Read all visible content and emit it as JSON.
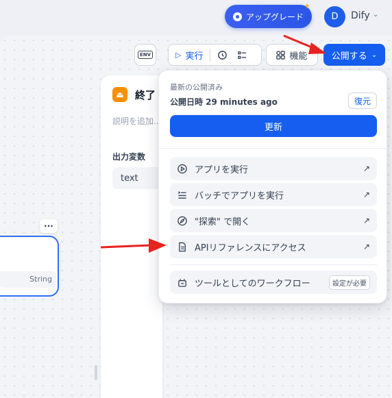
{
  "header": {
    "upgrade_label": "アップグレード",
    "user_initial": "D",
    "user_name": "Dify"
  },
  "toolbar": {
    "env_label": "ENV",
    "run_label": "実行",
    "feature_label": "機能",
    "publish_label": "公開する"
  },
  "end_node": {
    "title": "終了",
    "description_placeholder": "説明を追加...",
    "output_vars_label": "出力変数",
    "var_name": "text"
  },
  "left_node": {
    "var_type": "String",
    "more_label": "···"
  },
  "publish_menu": {
    "latest_label": "最新の公開済み",
    "published_at": "公開日時 29 minutes ago",
    "restore_label": "復元",
    "update_label": "更新",
    "items": [
      {
        "label": "アプリを実行",
        "icon": "play-circle-icon"
      },
      {
        "label": "バッチでアプリを実行",
        "icon": "batch-list-icon"
      },
      {
        "label": "\"探索\" で開く",
        "icon": "compass-icon"
      },
      {
        "label": "APIリファレンスにアクセス",
        "icon": "file-text-icon"
      }
    ],
    "tool_workflow_label": "ツールとしてのワークフロー",
    "tool_workflow_badge": "設定が必要"
  },
  "colors": {
    "primary": "#155eef",
    "end_node_icon": "#f79009",
    "arrow_red": "#e8231f"
  }
}
